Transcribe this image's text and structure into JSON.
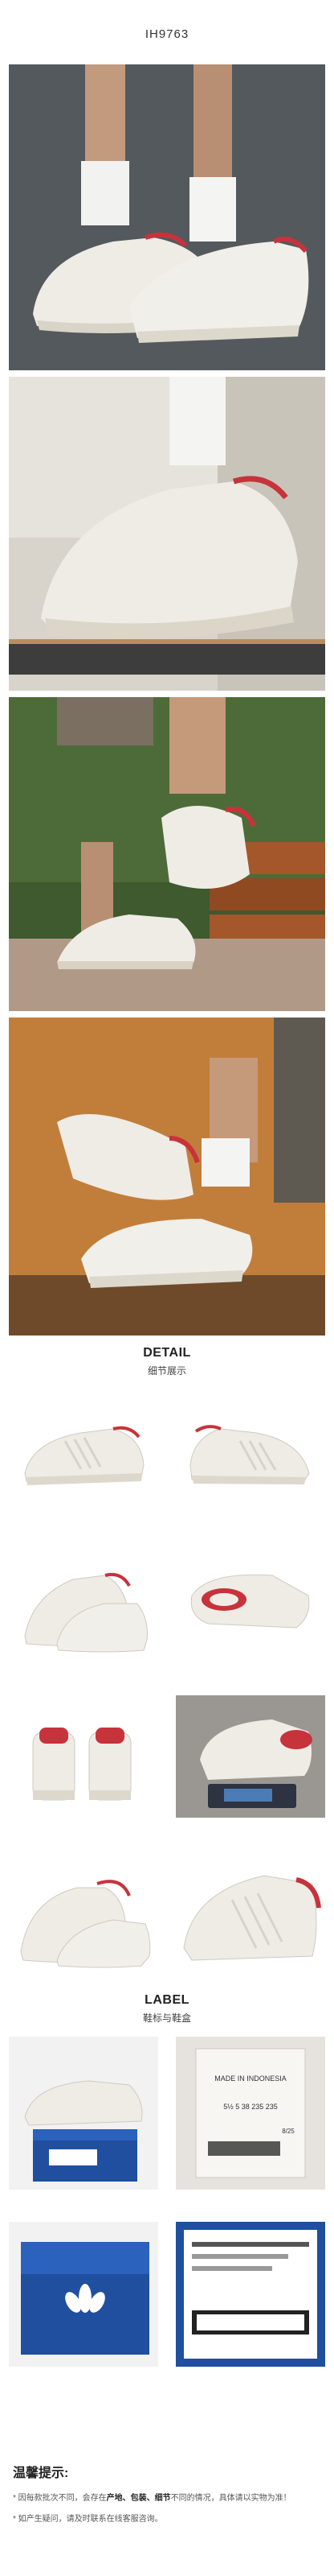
{
  "header": {
    "sku": "IH9763"
  },
  "detail": {
    "title_en": "DETAIL",
    "title_cn": "细节展示"
  },
  "label": {
    "title_en": "LABEL",
    "title_cn": "鞋标与鞋盒"
  },
  "tag_text": {
    "line1": "MADE IN INDONESIA",
    "sizes": "5½  5  38  235  235",
    "code": "8/25"
  },
  "tips": {
    "title": "温馨提示:",
    "items": [
      {
        "prefix": "* 因每款批次不同，会存在",
        "keywords": "产地、包装、细节",
        "suffix": "不同的情况，具体请以实物为准！"
      },
      {
        "prefix": "* 如产生疑问，请及时联系在线客服咨询。",
        "keywords": "",
        "suffix": ""
      }
    ]
  },
  "colors": {
    "shoe_white": "#efece6",
    "accent_red": "#c7333b",
    "box_blue": "#1f4f9e",
    "wood": "#a3572a",
    "lawn": "#3e5a2e"
  }
}
